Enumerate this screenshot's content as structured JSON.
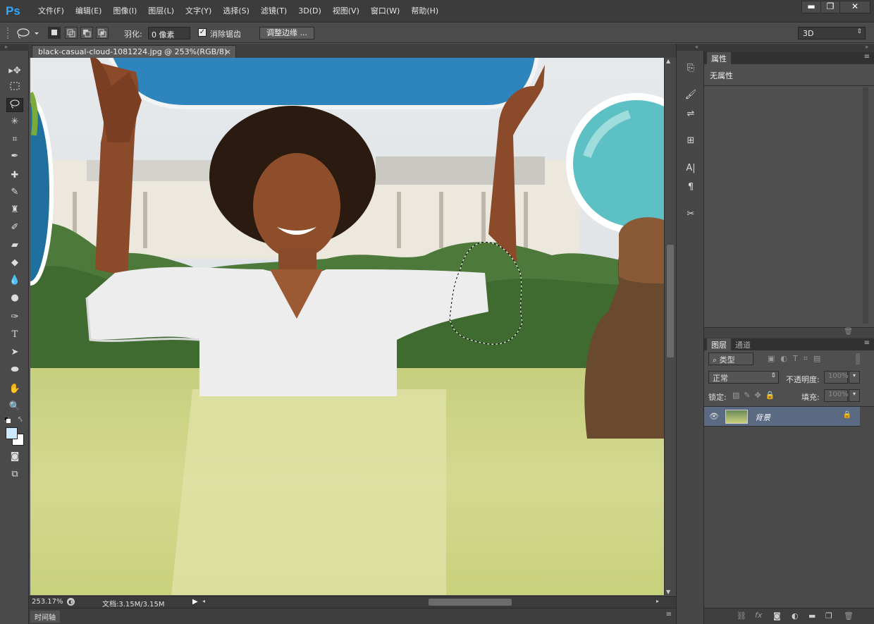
{
  "app": {
    "logo": "Ps"
  },
  "menubar": {
    "items": [
      "文件(F)",
      "编辑(E)",
      "图像(I)",
      "图层(L)",
      "文字(Y)",
      "选择(S)",
      "滤镜(T)",
      "3D(D)",
      "视图(V)",
      "窗口(W)",
      "帮助(H)"
    ],
    "window_controls": {
      "minimize": "▬",
      "restore": "❐",
      "close": "✕"
    }
  },
  "options": {
    "feather_label": "羽化:",
    "feather_value": "0 像素",
    "antialias_label": "消除锯齿",
    "antialias_checked": true,
    "refine_edge_label": "调整边缘 ...",
    "workspace": "3D"
  },
  "document": {
    "tab_title": "black-casual-cloud-1081224.jpg @ 253%(RGB/8) *",
    "zoom": "253.17%",
    "doc_info": "文档:3.15M/3.15M"
  },
  "timeline": {
    "label": "时间轴"
  },
  "properties": {
    "tab": "属性",
    "content": "无属性"
  },
  "layers_panel": {
    "tabs": [
      "图层",
      "通道"
    ],
    "filter_kind": "类型",
    "blend_mode": "正常",
    "opacity_label": "不透明度:",
    "opacity_value": "100%",
    "lock_label": "锁定:",
    "fill_label": "填充:",
    "fill_value": "100%",
    "layers": [
      {
        "name": "背景",
        "visible": true,
        "locked": true
      }
    ]
  },
  "colors": {
    "accent_blue": "#31a8ff",
    "foreground_color": "#cde9ff",
    "background_color": "#ffffff",
    "selected_layer": "#5a6a82"
  }
}
